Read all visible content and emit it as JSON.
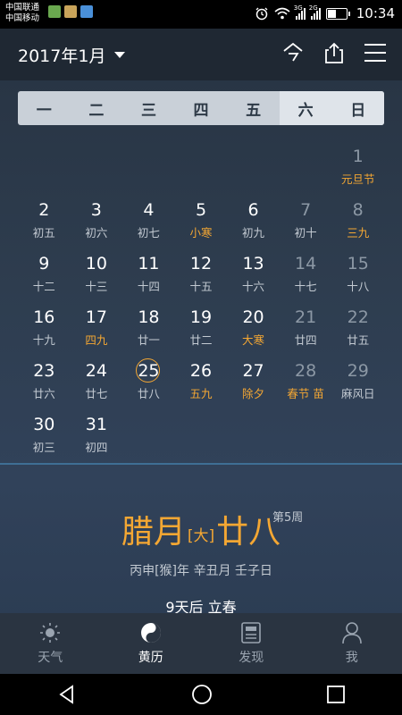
{
  "status_bar": {
    "carrier_1": "中国联通",
    "carrier_2": "中国移动",
    "network_1": "3G",
    "network_2": "2G",
    "time": "10:34"
  },
  "header": {
    "month_title": "2017年1月",
    "icons": [
      "today-icon",
      "share-icon",
      "menu-icon"
    ]
  },
  "weekdays": [
    "一",
    "二",
    "三",
    "四",
    "五",
    "六",
    "日"
  ],
  "calendar": {
    "rows": [
      [
        null,
        null,
        null,
        null,
        null,
        null,
        {
          "day": "1",
          "lunar": "元旦节",
          "highlight": true
        }
      ],
      [
        {
          "day": "2",
          "lunar": "初五"
        },
        {
          "day": "3",
          "lunar": "初六"
        },
        {
          "day": "4",
          "lunar": "初七"
        },
        {
          "day": "5",
          "lunar": "小寒",
          "highlight": true
        },
        {
          "day": "6",
          "lunar": "初九"
        },
        {
          "day": "7",
          "lunar": "初十"
        },
        {
          "day": "8",
          "lunar": "三九",
          "highlight": true
        }
      ],
      [
        {
          "day": "9",
          "lunar": "十二"
        },
        {
          "day": "10",
          "lunar": "十三"
        },
        {
          "day": "11",
          "lunar": "十四"
        },
        {
          "day": "12",
          "lunar": "十五"
        },
        {
          "day": "13",
          "lunar": "十六"
        },
        {
          "day": "14",
          "lunar": "十七"
        },
        {
          "day": "15",
          "lunar": "十八"
        }
      ],
      [
        {
          "day": "16",
          "lunar": "十九"
        },
        {
          "day": "17",
          "lunar": "四九",
          "highlight": true
        },
        {
          "day": "18",
          "lunar": "廿一"
        },
        {
          "day": "19",
          "lunar": "廿二"
        },
        {
          "day": "20",
          "lunar": "大寒",
          "highlight": true
        },
        {
          "day": "21",
          "lunar": "廿四"
        },
        {
          "day": "22",
          "lunar": "廿五"
        }
      ],
      [
        {
          "day": "23",
          "lunar": "廿六"
        },
        {
          "day": "24",
          "lunar": "廿七"
        },
        {
          "day": "25",
          "lunar": "廿八",
          "today": true
        },
        {
          "day": "26",
          "lunar": "五九",
          "highlight": true
        },
        {
          "day": "27",
          "lunar": "除夕",
          "highlight": true
        },
        {
          "day": "28",
          "lunar": "春节 苗",
          "highlight": true
        },
        {
          "day": "29",
          "lunar": "麻风日"
        }
      ],
      [
        {
          "day": "30",
          "lunar": "初三"
        },
        {
          "day": "31",
          "lunar": "初四"
        },
        null,
        null,
        null,
        null,
        null
      ]
    ]
  },
  "detail": {
    "lunar_month": "腊月",
    "month_size": "[大]",
    "lunar_day": "廿八",
    "week_number": "第5周",
    "ganzhi": "丙申[猴]年  辛丑月  壬子日",
    "solar_term_countdown": "9天后  立春"
  },
  "bottom_nav": [
    {
      "label": "天气",
      "icon": "sun-icon"
    },
    {
      "label": "黄历",
      "icon": "yin-yang-icon",
      "active": true
    },
    {
      "label": "发现",
      "icon": "newspaper-icon"
    },
    {
      "label": "我",
      "icon": "person-icon"
    }
  ],
  "colors": {
    "accent": "#f4a733",
    "background": "#2e3d4f",
    "weekhead": "#c9d0d8"
  }
}
